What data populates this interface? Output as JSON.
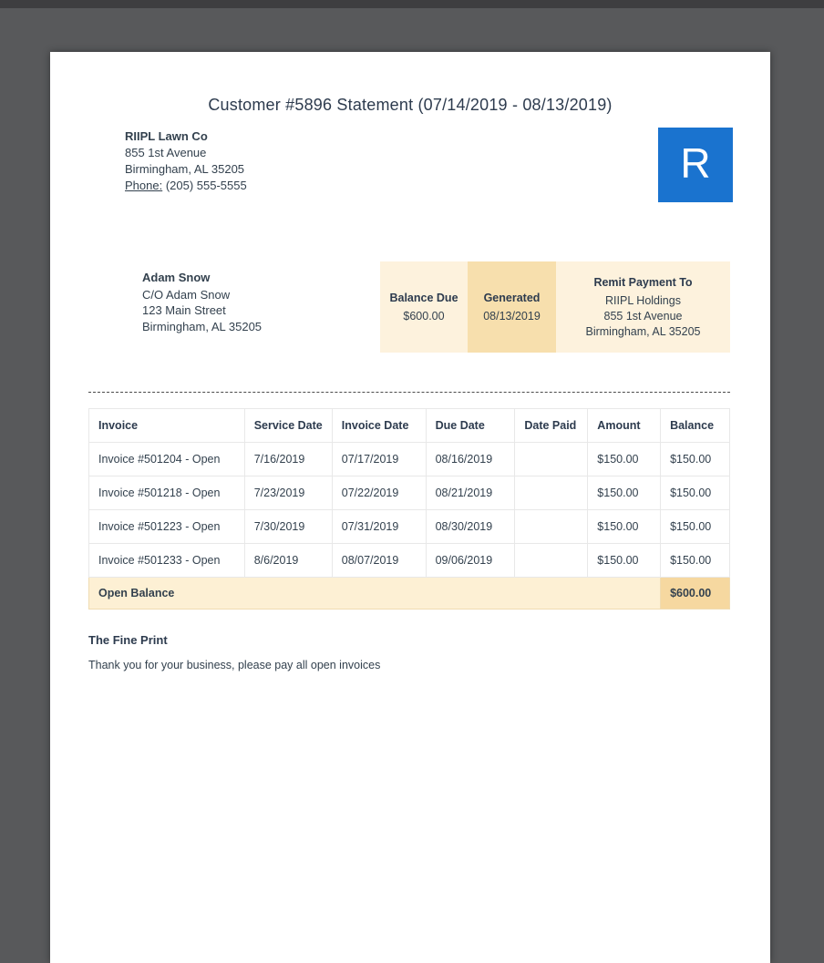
{
  "doc": {
    "title": "Customer #5896 Statement (07/14/2019 - 08/13/2019)"
  },
  "company": {
    "name": "RIIPL Lawn Co",
    "address1": "855 1st Avenue",
    "address2": "Birmingham, AL 35205",
    "phone_label": "Phone:",
    "phone": "(205) 555-5555",
    "logo_letter": "R",
    "logo_color": "#1a73cf"
  },
  "customer": {
    "name": "Adam Snow",
    "line1": "C/O Adam Snow",
    "line2": "123 Main Street",
    "line3": "Birmingham, AL 35205"
  },
  "summary": {
    "balance_due_label": "Balance Due",
    "balance_due_value": "$600.00",
    "generated_label": "Generated",
    "generated_value": "08/13/2019",
    "remit_label": "Remit Payment To",
    "remit_name": "RIIPL Holdings",
    "remit_address1": "855 1st Avenue",
    "remit_address2": "Birmingham, AL 35205",
    "cream_color": "#fdf2dd",
    "tan_color": "#f7dfad"
  },
  "table": {
    "headers": [
      "Invoice",
      "Service Date",
      "Invoice Date",
      "Due Date",
      "Date Paid",
      "Amount",
      "Balance"
    ],
    "rows": [
      [
        "Invoice #501204 - Open",
        "7/16/2019",
        "07/17/2019",
        "08/16/2019",
        "",
        "$150.00",
        "$150.00"
      ],
      [
        "Invoice #501218 - Open",
        "7/23/2019",
        "07/22/2019",
        "08/21/2019",
        "",
        "$150.00",
        "$150.00"
      ],
      [
        "Invoice #501223 - Open",
        "7/30/2019",
        "07/31/2019",
        "08/30/2019",
        "",
        "$150.00",
        "$150.00"
      ],
      [
        "Invoice #501233 - Open",
        "8/6/2019",
        "08/07/2019",
        "09/06/2019",
        "",
        "$150.00",
        "$150.00"
      ]
    ],
    "footer_label": "Open Balance",
    "footer_balance": "$600.00"
  },
  "fine_print": {
    "heading": "The Fine Print",
    "text": "Thank you for your business, please pay all open invoices"
  }
}
